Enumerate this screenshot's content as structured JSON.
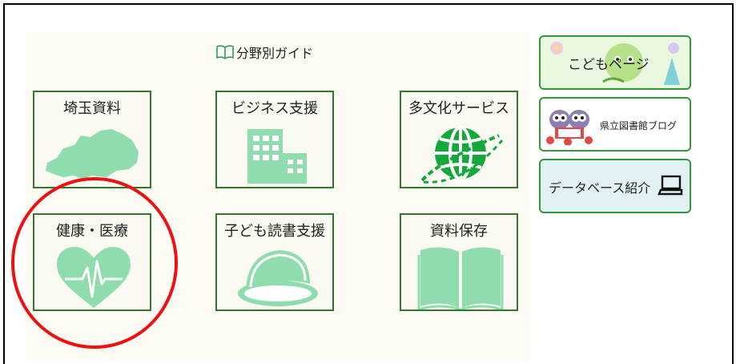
{
  "guide": {
    "title": "分野別ガイド"
  },
  "tiles": [
    {
      "label": "埼玉資料"
    },
    {
      "label": "ビジネス支援"
    },
    {
      "label": "多文化サービス"
    },
    {
      "label": "健康・医療"
    },
    {
      "label": "子ども読書支援"
    },
    {
      "label": "資料保存"
    }
  ],
  "sidebar": {
    "kids": {
      "label": "こどもページ"
    },
    "blog": {
      "label": "県立図書館ブログ"
    },
    "database": {
      "label": "データベース紹介"
    }
  },
  "colors": {
    "tile_border": "#2e7a2a",
    "icon_fill": "#8fdcae",
    "annotation": "#ee1111"
  }
}
